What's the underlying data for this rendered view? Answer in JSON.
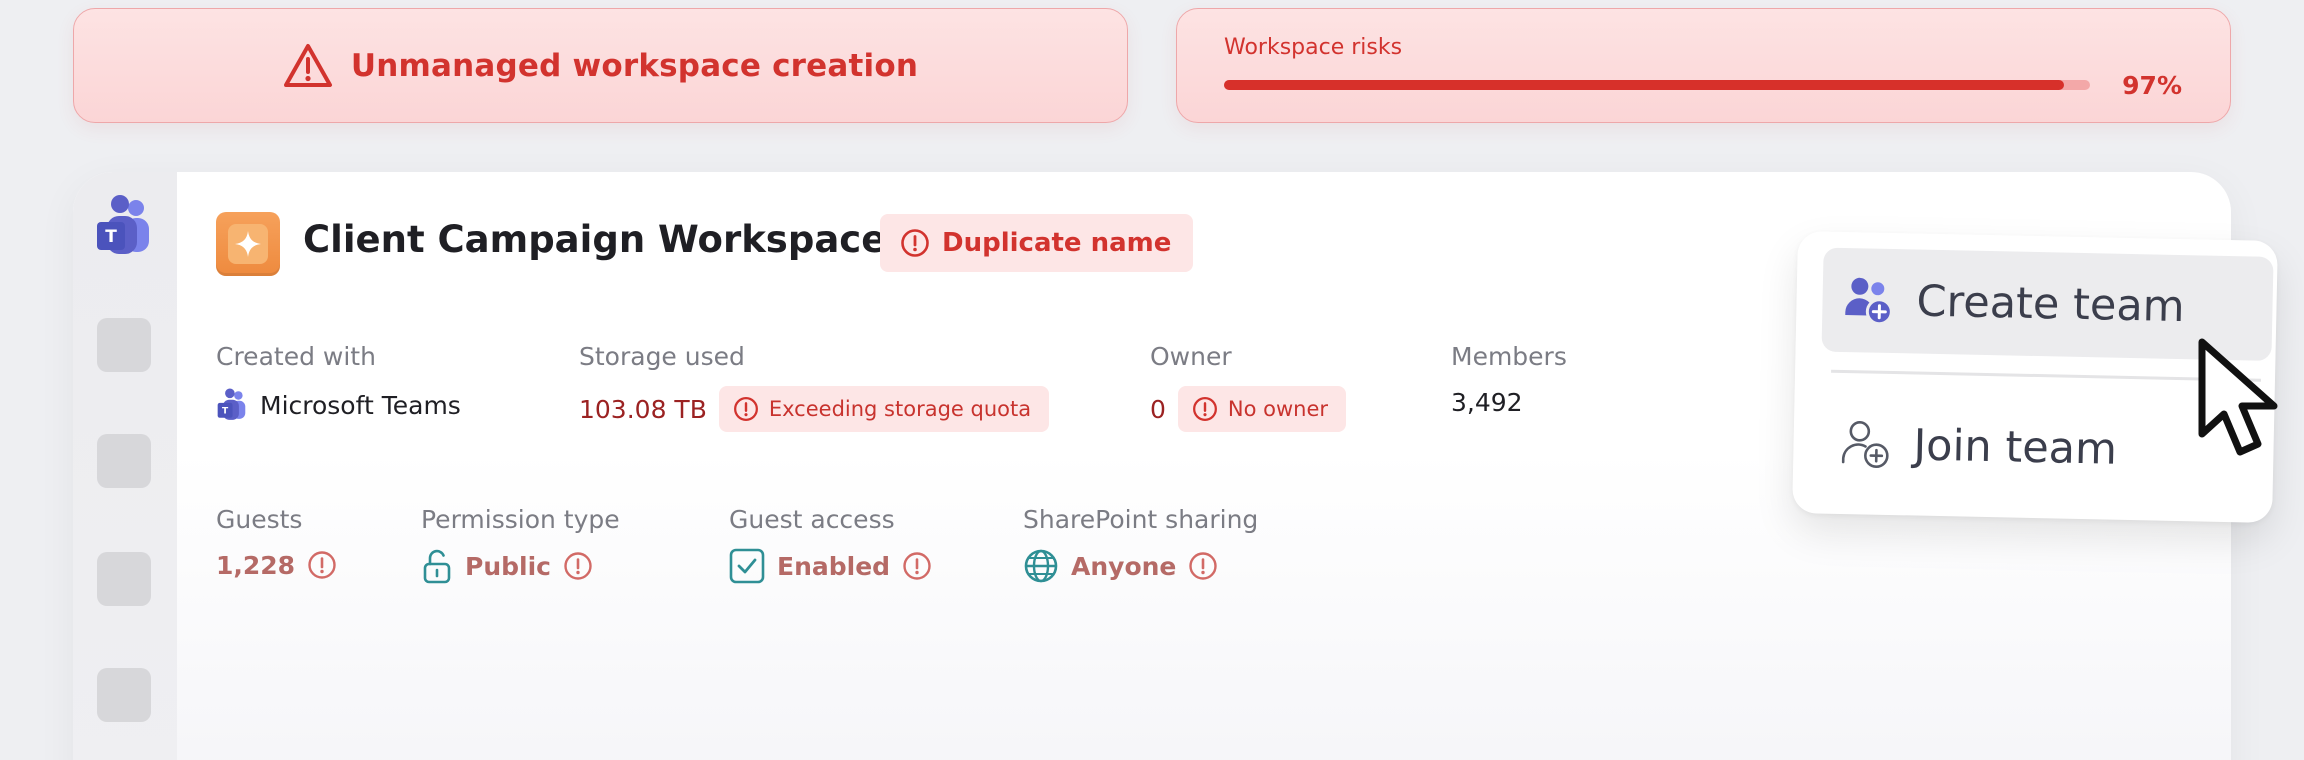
{
  "banners": {
    "left": {
      "title": "Unmanaged workspace creation",
      "icon": "warning-triangle-icon"
    },
    "right": {
      "label": "Workspace risks",
      "percent_text": "97%",
      "progress": 0.97
    }
  },
  "workspace": {
    "name": "Client Campaign Workspace",
    "badge": "Duplicate name",
    "fields": {
      "created_with": {
        "label": "Created with",
        "value": "Microsoft Teams"
      },
      "storage_used": {
        "label": "Storage used",
        "value": "103.08 TB",
        "warning": "Exceeding storage quota"
      },
      "owner": {
        "label": "Owner",
        "value": "0",
        "warning": "No owner"
      },
      "members": {
        "label": "Members",
        "value": "3,492"
      },
      "guests": {
        "label": "Guests",
        "value": "1,228"
      },
      "permission_type": {
        "label": "Permission type",
        "value": "Public"
      },
      "guest_access": {
        "label": "Guest access",
        "value": "Enabled"
      },
      "sharepoint_sharing": {
        "label": "SharePoint sharing",
        "value": "Anyone"
      }
    }
  },
  "menu": {
    "items": [
      {
        "label": "Create team",
        "icon": "create-team-icon",
        "active": true
      },
      {
        "label": "Join team",
        "icon": "join-team-icon",
        "active": false
      }
    ]
  },
  "colors": {
    "alert_red": "#d2332e",
    "alert_bg": "#fde6e6",
    "teal_icon": "#2f8f95",
    "teams_purple": "#5b5fc7"
  }
}
